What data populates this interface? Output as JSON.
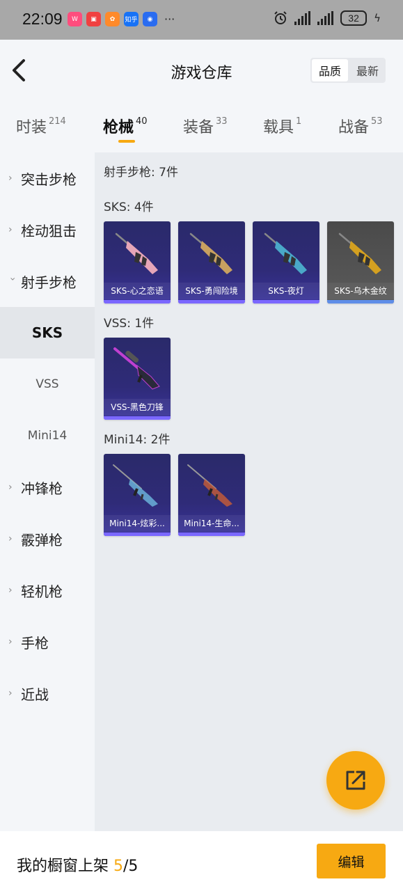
{
  "status_bar": {
    "time": "22:09",
    "more": "···",
    "battery": "32",
    "apps": [
      {
        "icon": "vivo-app-icon",
        "color": "#ff4d7d",
        "text": "W"
      },
      {
        "icon": "red-app-icon",
        "color": "#f04040",
        "text": "▣"
      },
      {
        "icon": "orange-app-icon",
        "color": "#ff8a2a",
        "text": "✿"
      },
      {
        "icon": "zhihu-icon",
        "color": "#1772f6",
        "text": "知乎"
      },
      {
        "icon": "blue-app-icon",
        "color": "#2a6cf0",
        "text": "◉"
      }
    ]
  },
  "header": {
    "title": "游戏仓库",
    "sort_options": [
      "品质",
      "最新"
    ],
    "sort_active": 0
  },
  "tabs": [
    {
      "label": "时装",
      "count": "214"
    },
    {
      "label": "枪械",
      "count": "40",
      "active": true
    },
    {
      "label": "装备",
      "count": "33"
    },
    {
      "label": "载具",
      "count": "1"
    },
    {
      "label": "战备",
      "count": "53"
    }
  ],
  "sidebar": {
    "items": [
      {
        "label": "突击步枪",
        "expanded": false
      },
      {
        "label": "栓动狙击",
        "expanded": false
      },
      {
        "label": "射手步枪",
        "expanded": true
      },
      {
        "label": "冲锋枪",
        "expanded": false
      },
      {
        "label": "霰弹枪",
        "expanded": false
      },
      {
        "label": "轻机枪",
        "expanded": false
      },
      {
        "label": "手枪",
        "expanded": false
      },
      {
        "label": "近战",
        "expanded": false
      }
    ],
    "subitems": [
      {
        "label": "SKS",
        "active": true
      },
      {
        "label": "VSS",
        "active": false
      },
      {
        "label": "Mini14",
        "active": false
      }
    ]
  },
  "content": {
    "category_title": "射手步枪: 7件",
    "groups": [
      {
        "title": "SKS: 4件",
        "items": [
          {
            "name": "SKS-心之恋语",
            "style": "purple",
            "gun_color": "#e6a6b8"
          },
          {
            "name": "SKS-勇闯险境",
            "style": "purple",
            "gun_color": "#c8a060"
          },
          {
            "name": "SKS-夜灯",
            "style": "purple",
            "gun_color": "#4aa8c8"
          },
          {
            "name": "SKS-乌木金纹",
            "style": "gray",
            "gun_color": "#d4a020"
          }
        ]
      },
      {
        "title": "VSS: 1件",
        "items": [
          {
            "name": "VSS-黑色刀锋",
            "style": "purple",
            "gun_color": "#c040d0"
          }
        ]
      },
      {
        "title": "Mini14: 2件",
        "items": [
          {
            "name": "Mini14-炫彩...",
            "style": "purple",
            "gun_color": "#6ab0d8"
          },
          {
            "name": "Mini14-生命...",
            "style": "purple",
            "gun_color": "#c05a3a"
          }
        ]
      }
    ]
  },
  "bottom_bar": {
    "label": "我的橱窗上架",
    "count_current": "5",
    "count_total": "/5",
    "edit_label": "编辑"
  },
  "colors": {
    "accent": "#f7a912",
    "card_purple": "#2f2b78",
    "card_gray": "#555555"
  }
}
